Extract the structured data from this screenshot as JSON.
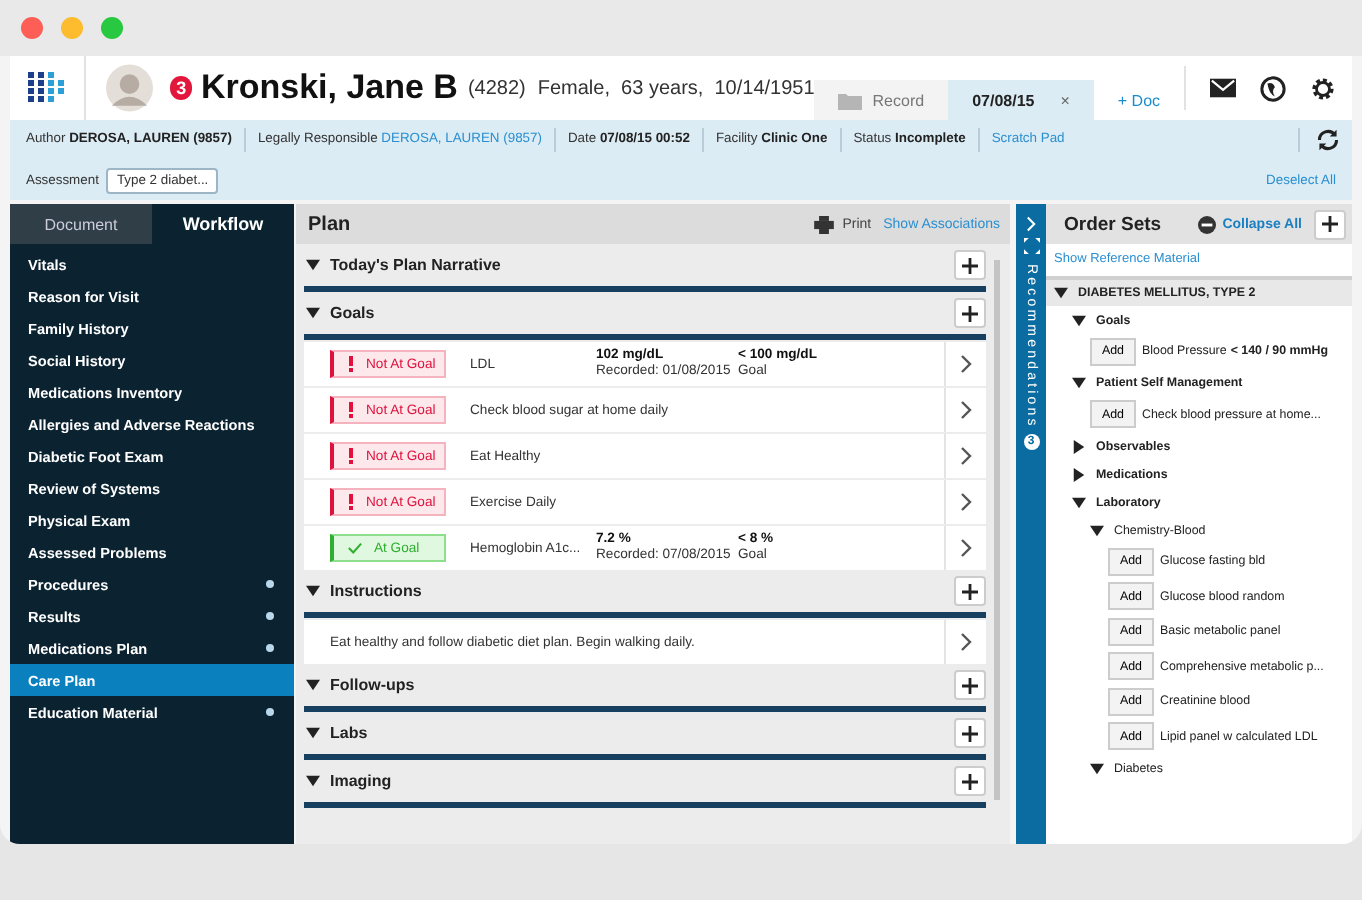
{
  "header": {
    "patient": {
      "alert_count": "3",
      "name": "Kronski, Jane B",
      "id": "(4282)",
      "details": "Female,  63 years,  10/14/1951"
    },
    "tabs": [
      {
        "kind": "record",
        "label": "Record",
        "selected": false
      },
      {
        "kind": "document",
        "label": "07/08/15",
        "close": "×",
        "selected": true
      },
      {
        "kind": "add",
        "label": "+ Doc",
        "selected": false
      }
    ]
  },
  "info_bar": {
    "fields": [
      {
        "label": "Author",
        "value": "DEROSA, LAUREN (9857)",
        "kind": "bold"
      },
      {
        "label": "Legally Responsible",
        "value": "DEROSA, LAUREN (9857)",
        "kind": "link"
      },
      {
        "label": "Date",
        "value": "07/08/15 00:52",
        "kind": "bold"
      },
      {
        "label": "Facility",
        "value": "Clinic One",
        "kind": "bold"
      },
      {
        "label": "Status",
        "value": "Incomplete",
        "kind": "bold"
      }
    ],
    "scratch_pad": "Scratch Pad",
    "assessment": {
      "label": "Assessment",
      "value": "Type 2 diabet..."
    },
    "deselect_all": "Deselect All"
  },
  "sidebar": {
    "tabs": [
      {
        "label": "Document",
        "selected": false
      },
      {
        "label": "Workflow",
        "selected": true
      }
    ],
    "items": [
      {
        "label": "Vitals",
        "selected": false,
        "indicator": false
      },
      {
        "label": "Reason for Visit",
        "selected": false,
        "indicator": false
      },
      {
        "label": "Family History",
        "selected": false,
        "indicator": false
      },
      {
        "label": "Social History",
        "selected": false,
        "indicator": false
      },
      {
        "label": "Medications Inventory",
        "selected": false,
        "indicator": false
      },
      {
        "label": "Allergies and Adverse Reactions",
        "selected": false,
        "indicator": false
      },
      {
        "label": "Diabetic Foot Exam",
        "selected": false,
        "indicator": false
      },
      {
        "label": "Review of Systems",
        "selected": false,
        "indicator": false
      },
      {
        "label": "Physical Exam",
        "selected": false,
        "indicator": false
      },
      {
        "label": "Assessed Problems",
        "selected": false,
        "indicator": false
      },
      {
        "label": "Procedures",
        "selected": false,
        "indicator": true
      },
      {
        "label": "Results",
        "selected": false,
        "indicator": true
      },
      {
        "label": "Medications Plan",
        "selected": false,
        "indicator": true
      },
      {
        "label": "Care Plan",
        "selected": true,
        "indicator": false
      },
      {
        "label": "Education Material",
        "selected": false,
        "indicator": true
      }
    ]
  },
  "plan": {
    "title": "Plan",
    "print": "Print",
    "show_associations": "Show Associations",
    "sections": [
      {
        "title": "Today's Plan Narrative",
        "expanded": true
      },
      {
        "title": "Goals",
        "expanded": true,
        "items": [
          {
            "kind": "goal",
            "at_goal": false,
            "status_label": "Not At Goal",
            "name": "LDL",
            "value": "102 mg/dL",
            "recorded": "Recorded: 01/08/2015",
            "target": "< 100 mg/dL",
            "target_label": "Goal"
          },
          {
            "kind": "goal",
            "at_goal": false,
            "status_label": "Not At Goal",
            "name": "Check blood sugar at home daily"
          },
          {
            "kind": "goal",
            "at_goal": false,
            "status_label": "Not At Goal",
            "name": "Eat Healthy"
          },
          {
            "kind": "goal",
            "at_goal": false,
            "status_label": "Not At Goal",
            "name": "Exercise Daily"
          },
          {
            "kind": "goal",
            "at_goal": true,
            "status_label": "At Goal",
            "name": "Hemoglobin A1c...",
            "value": "7.2 %",
            "recorded": "Recorded: 07/08/2015",
            "target": "< 8 %",
            "target_label": "Goal"
          }
        ]
      },
      {
        "title": "Instructions",
        "expanded": true,
        "items": [
          {
            "kind": "text",
            "text": "Eat healthy and follow diabetic diet plan.  Begin walking daily."
          }
        ]
      },
      {
        "title": "Follow-ups",
        "expanded": true
      },
      {
        "title": "Labs",
        "expanded": true
      },
      {
        "title": "Imaging",
        "expanded": true
      }
    ]
  },
  "recommendations": {
    "label": "Recommendations",
    "count": "3"
  },
  "order_sets": {
    "title": "Order Sets",
    "collapse_all": "Collapse All",
    "show_reference": "Show Reference Material",
    "tree": [
      {
        "kind": "category",
        "label": "DIABETES MELLITUS, TYPE 2",
        "expanded": true,
        "children": [
          {
            "kind": "group",
            "label": "Goals",
            "expanded": true,
            "children": [
              {
                "kind": "order",
                "action": "Add",
                "label": "Blood Pressure",
                "target": "< 140 / 90 mmHg"
              }
            ]
          },
          {
            "kind": "group",
            "label": "Patient Self Management",
            "expanded": true,
            "children": [
              {
                "kind": "order",
                "action": "Add",
                "label": "Check blood pressure at home..."
              }
            ]
          },
          {
            "kind": "group",
            "label": "Observables",
            "expanded": false
          },
          {
            "kind": "group",
            "label": "Medications",
            "expanded": false
          },
          {
            "kind": "group",
            "label": "Laboratory",
            "expanded": true,
            "children": [
              {
                "kind": "subgroup",
                "label": "Chemistry-Blood",
                "expanded": true,
                "children": [
                  {
                    "kind": "order",
                    "action": "Add",
                    "label": "Glucose fasting bld"
                  },
                  {
                    "kind": "order",
                    "action": "Add",
                    "label": "Glucose blood random"
                  },
                  {
                    "kind": "order",
                    "action": "Add",
                    "label": "Basic metabolic panel"
                  },
                  {
                    "kind": "order",
                    "action": "Add",
                    "label": "Comprehensive metabolic p..."
                  },
                  {
                    "kind": "order",
                    "action": "Add",
                    "label": "Creatinine blood"
                  },
                  {
                    "kind": "order",
                    "action": "Add",
                    "label": "Lipid panel w calculated LDL"
                  }
                ]
              },
              {
                "kind": "subgroup",
                "label": "Diabetes",
                "expanded": true
              }
            ]
          }
        ]
      }
    ]
  }
}
